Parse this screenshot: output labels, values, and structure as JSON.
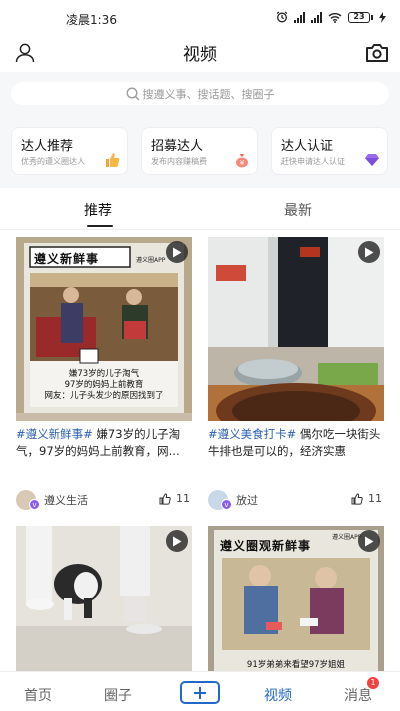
{
  "status_bar": {
    "time": "凌晨1:36",
    "network": "4G",
    "battery": "23"
  },
  "header": {
    "title": "视频"
  },
  "search": {
    "placeholder": "搜遵义事、搜话题、搜圈子"
  },
  "feature_cards": [
    {
      "title": "达人推荐",
      "subtitle": "优秀的遵义圈达人"
    },
    {
      "title": "招募达人",
      "subtitle": "发布内容赚稿费"
    },
    {
      "title": "达人认证",
      "subtitle": "赶快申请达人认证"
    }
  ],
  "tabs": {
    "active": "推荐",
    "inactive": "最新"
  },
  "posts": [
    {
      "hashtag": "#遵义新鲜事#",
      "text": " 嫌73岁的儿子淘气，97岁的妈妈上前教育，网...",
      "author": "遵义生活",
      "likes": "11",
      "thumb_banner": "遵义新鲜事",
      "thumb_caption_1": "嫌73岁的儿子淘气",
      "thumb_caption_2": "97岁的妈妈上前教育",
      "thumb_caption_3": "网友：儿子头发少的原因找到了",
      "thumb_logo": "遵义圈APP"
    },
    {
      "hashtag": "#遵义美食打卡#",
      "text": " 偶尔吃一块街头牛排也是可以的，经济实惠",
      "author": "放过",
      "likes": "11"
    },
    {
      "text": "",
      "author": "",
      "likes": ""
    },
    {
      "thumb_banner": "遵义圈观新鲜事",
      "thumb_caption": "91岁弟弟来看望97岁姐姐",
      "thumb_logo": "遵义圈APP",
      "text": "",
      "author": "",
      "likes": ""
    }
  ],
  "tabbar": {
    "home": "首页",
    "circle": "圈子",
    "video": "视频",
    "messages": "消息",
    "messages_badge": "1"
  },
  "colors": {
    "accent": "#2368c8",
    "hashtag": "#2a5fb0",
    "badge": "#f24141",
    "verified": "#8a5cf0"
  }
}
